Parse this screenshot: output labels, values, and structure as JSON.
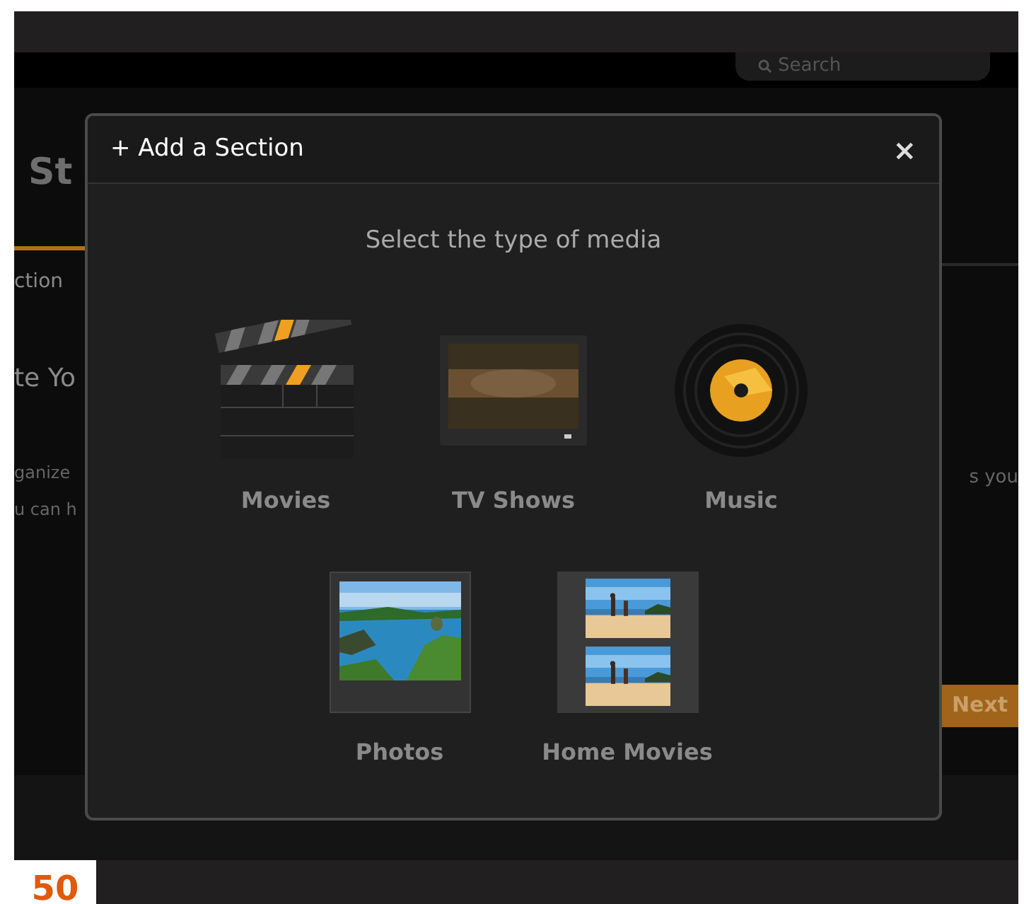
{
  "header": {
    "search": {
      "placeholder": "Search"
    }
  },
  "background_page": {
    "title": "St",
    "tab": "ction",
    "heading": "te Yo",
    "text_lines": [
      "ganize",
      "u can h"
    ],
    "text_right": "s you",
    "next_button": "Next"
  },
  "dialog": {
    "title": "+ Add a Section",
    "close": "×",
    "prompt": "Select the type of media",
    "media_types": [
      {
        "label": "Movies",
        "kind": "movies"
      },
      {
        "label": "TV Shows",
        "kind": "tv"
      },
      {
        "label": "Music",
        "kind": "music"
      },
      {
        "label": "Photos",
        "kind": "photos"
      },
      {
        "label": "Home Movies",
        "kind": "home_movies"
      }
    ]
  },
  "page_number": "50"
}
